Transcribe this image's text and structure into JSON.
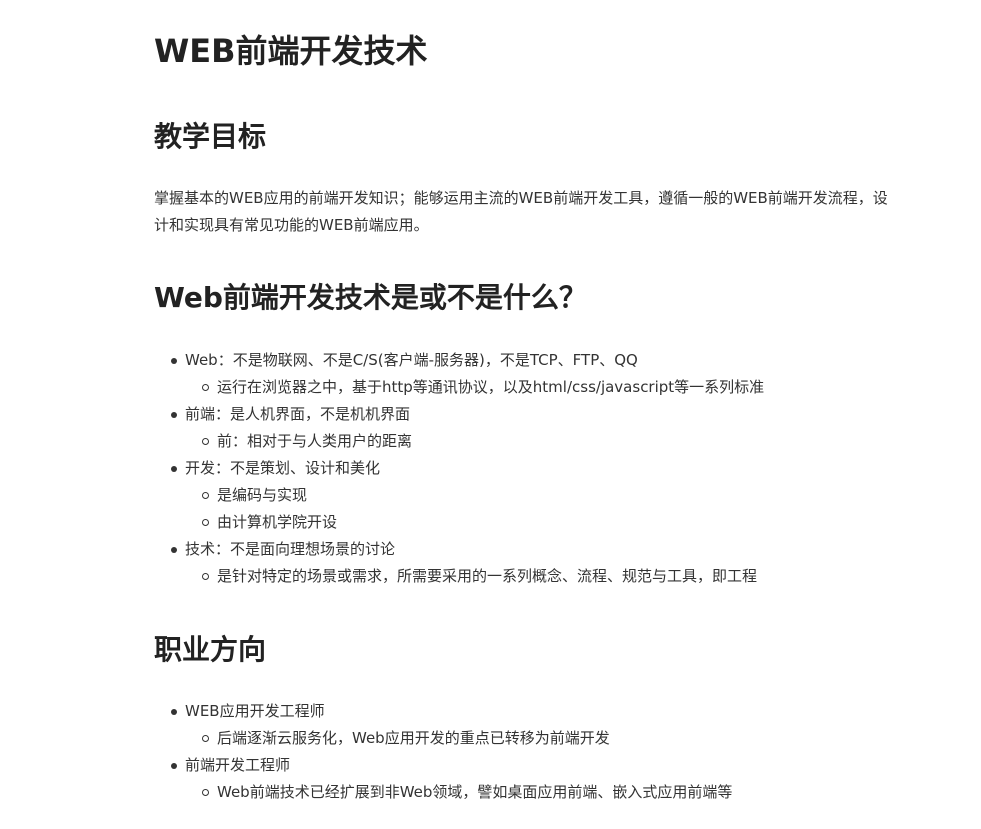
{
  "title": "WEB前端开发技术",
  "sections": {
    "goal": {
      "heading": "教学目标",
      "paragraph": "掌握基本的WEB应用的前端开发知识；能够运用主流的WEB前端开发工具，遵循一般的WEB前端开发流程，设计和实现具有常见功能的WEB前端应用。"
    },
    "what": {
      "heading": "Web前端开发技术是或不是什么？",
      "items": [
        {
          "text": "Web：不是物联网、不是C/S(客户端-服务器)，不是TCP、FTP、QQ"
        },
        {
          "text": "运行在浏览器之中，基于http等通讯协议，以及html/css/javascript等一系列标准"
        },
        {
          "text": "前端：是人机界面，不是机机界面"
        },
        {
          "text": "前：相对于与人类用户的距离"
        },
        {
          "text": "开发：不是策划、设计和美化"
        },
        {
          "text": "是编码与实现"
        },
        {
          "text": "由计算机学院开设"
        },
        {
          "text": "技术：不是面向理想场景的讨论"
        },
        {
          "text": "是针对特定的场景或需求，所需要采用的一系列概念、流程、规范与工具，即工程"
        }
      ]
    },
    "career": {
      "heading": "职业方向",
      "items": [
        {
          "text": "WEB应用开发工程师"
        },
        {
          "text": "后端逐渐云服务化，Web应用开发的重点已转移为前端开发"
        },
        {
          "text": "前端开发工程师"
        },
        {
          "text": "Web前端技术已经扩展到非Web领域，譬如桌面应用前端、嵌入式应用前端等"
        }
      ]
    }
  }
}
